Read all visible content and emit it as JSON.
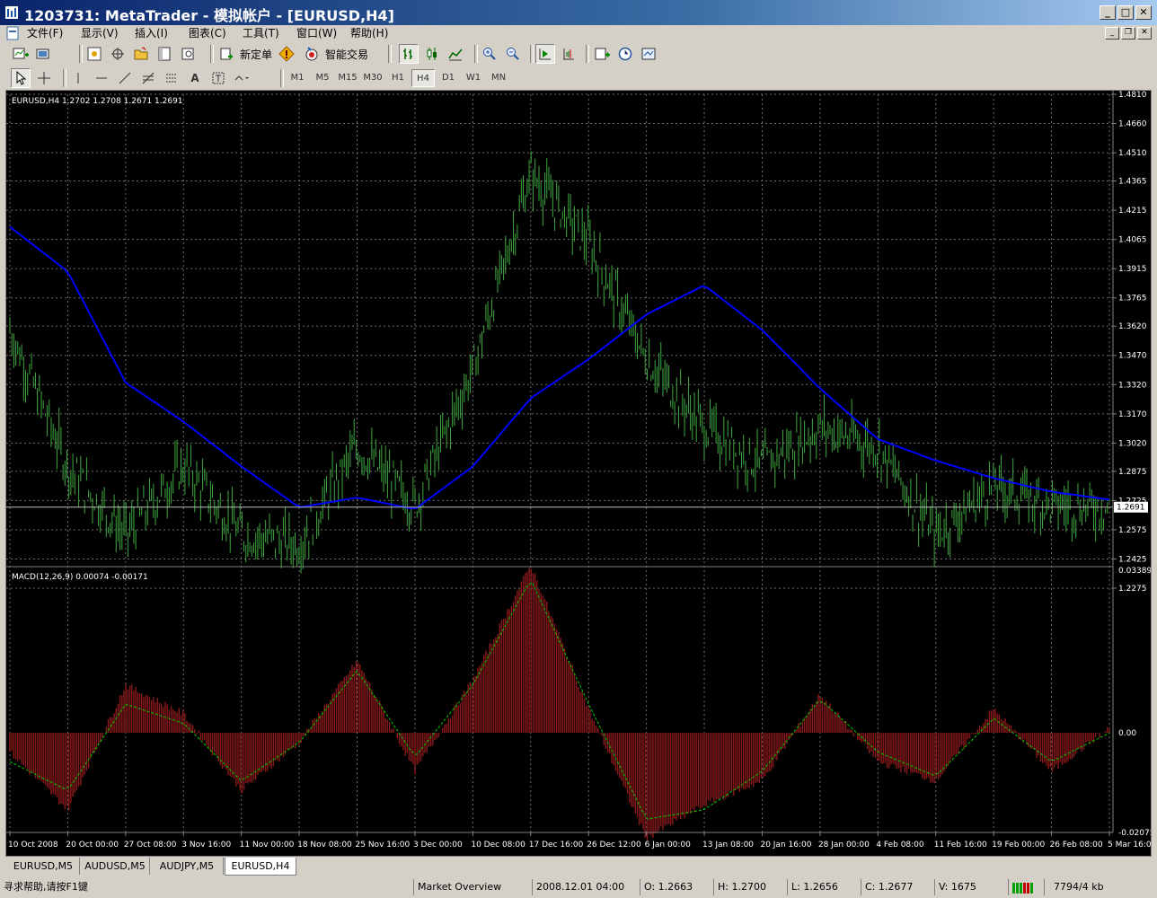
{
  "window": {
    "title": "1203731: MetaTrader - 模拟帐户 - [EURUSD,H4]"
  },
  "menu": [
    "文件(F)",
    "显示(V)",
    "插入(I)",
    "图表(C)",
    "工具(T)",
    "窗口(W)",
    "帮助(H)"
  ],
  "toolbar": {
    "new_order": "新定单",
    "expert_advisors": "智能交易"
  },
  "timeframes": [
    "M1",
    "M5",
    "M15",
    "M30",
    "H1",
    "H4",
    "D1",
    "W1",
    "MN"
  ],
  "active_timeframe": "H4",
  "chart_data": [
    {
      "type": "bar",
      "info_label": "EURUSD,H4  1.2702 1.2708 1.2671 1.2691",
      "y_ticks": [
        "1.4810",
        "1.4660",
        "1.4510",
        "1.4365",
        "1.4215",
        "1.4065",
        "1.3915",
        "1.3765",
        "1.3620",
        "1.3470",
        "1.3320",
        "1.3170",
        "1.3020",
        "1.2875",
        "1.2725",
        "1.2575",
        "1.2425",
        "1.2275"
      ],
      "ylim": [
        1.2275,
        1.481
      ],
      "current_price": "1.2691",
      "series": [
        {
          "name": "",
          "color": "#3fa83f",
          "x": [
            "10 Oct 2008",
            "20 Oct 00:00",
            "27 Oct 08:00",
            "3 Nov 16:00",
            "11 Nov 00:00",
            "18 Nov 08:00",
            "25 Nov 16:00",
            "3 Dec 00:00",
            "10 Dec 08:00",
            "17 Dec 16:00",
            "26 Dec 12:00",
            "6 Jan 00:00",
            "13 Jan 08:00",
            "20 Jan 16:00",
            "28 Jan 00:00",
            "4 Feb 08:00",
            "11 Feb 16:00",
            "19 Feb 00:00",
            "26 Feb 08:00",
            "5 Mar 16:00"
          ],
          "values": [
            1.36,
            1.29,
            1.255,
            1.29,
            1.255,
            1.25,
            1.3,
            1.27,
            1.34,
            1.44,
            1.405,
            1.345,
            1.31,
            1.29,
            1.31,
            1.3,
            1.255,
            1.28,
            1.27,
            1.269
          ]
        },
        {
          "name": "",
          "color": "#0000ff",
          "x": [
            "10 Oct 2008",
            "20 Oct 00:00",
            "27 Oct 08:00",
            "3 Nov 16:00",
            "11 Nov 00:00",
            "18 Nov 08:00",
            "25 Nov 16:00",
            "3 Dec 00:00",
            "10 Dec 08:00",
            "17 Dec 16:00",
            "26 Dec 12:00",
            "6 Jan 00:00",
            "13 Jan 08:00",
            "20 Jan 16:00",
            "28 Jan 00:00",
            "4 Feb 08:00",
            "11 Feb 16:00",
            "19 Feb 00:00",
            "26 Feb 08:00",
            "5 Mar 16:00"
          ],
          "values": [
            1.413,
            1.39,
            1.333,
            1.313,
            1.29,
            1.269,
            1.274,
            1.268,
            1.29,
            1.325,
            1.345,
            1.368,
            1.383,
            1.36,
            1.33,
            1.304,
            1.293,
            1.284,
            1.277,
            1.273
          ]
        }
      ]
    },
    {
      "type": "bar",
      "info_label": "MACD(12,26,9) 0.00074 -0.00171",
      "y_ticks": [
        "0.03389",
        "0.00",
        "-0.02075"
      ],
      "ylim": [
        -0.02075,
        0.03389
      ],
      "series": [
        {
          "name": "",
          "color": "#8b1a1a",
          "x": [
            "10 Oct 2008",
            "20 Oct 00:00",
            "27 Oct 08:00",
            "3 Nov 16:00",
            "11 Nov 00:00",
            "18 Nov 08:00",
            "25 Nov 16:00",
            "3 Dec 00:00",
            "10 Dec 08:00",
            "17 Dec 16:00",
            "26 Dec 12:00",
            "6 Jan 00:00",
            "13 Jan 08:00",
            "20 Jan 16:00",
            "28 Jan 00:00",
            "4 Feb 08:00",
            "11 Feb 16:00",
            "19 Feb 00:00",
            "26 Feb 08:00",
            "5 Mar 16:00"
          ],
          "values": [
            -0.004,
            -0.016,
            0.01,
            0.004,
            -0.012,
            -0.002,
            0.015,
            -0.008,
            0.011,
            0.035,
            0.005,
            -0.022,
            -0.015,
            -0.01,
            0.008,
            -0.006,
            -0.01,
            0.005,
            -0.008,
            0.001
          ]
        },
        {
          "name": "",
          "color": "#00cc00",
          "x": [
            "10 Oct 2008",
            "20 Oct 00:00",
            "27 Oct 08:00",
            "3 Nov 16:00",
            "11 Nov 00:00",
            "18 Nov 08:00",
            "25 Nov 16:00",
            "3 Dec 00:00",
            "10 Dec 08:00",
            "17 Dec 16:00",
            "26 Dec 12:00",
            "6 Jan 00:00",
            "13 Jan 08:00",
            "20 Jan 16:00",
            "28 Jan 00:00",
            "4 Feb 08:00",
            "11 Feb 16:00",
            "19 Feb 00:00",
            "26 Feb 08:00",
            "5 Mar 16:00"
          ],
          "values": [
            -0.006,
            -0.012,
            0.006,
            0.002,
            -0.01,
            -0.002,
            0.013,
            -0.005,
            0.01,
            0.032,
            0.006,
            -0.018,
            -0.016,
            -0.008,
            0.007,
            -0.004,
            -0.009,
            0.003,
            -0.006,
            0.0
          ]
        }
      ]
    }
  ],
  "x_tick_labels": [
    "10 Oct 2008",
    "20 Oct 00:00",
    "27 Oct 08:00",
    "3 Nov 16:00",
    "11 Nov 00:00",
    "18 Nov 08:00",
    "25 Nov 16:00",
    "3 Dec 00:00",
    "10 Dec 08:00",
    "17 Dec 16:00",
    "26 Dec 12:00",
    "6 Jan 00:00",
    "13 Jan 08:00",
    "20 Jan 16:00",
    "28 Jan 00:00",
    "4 Feb 08:00",
    "11 Feb 16:00",
    "19 Feb 00:00",
    "26 Feb 08:00",
    "5 Mar 16:00"
  ],
  "tabs": [
    "EURUSD,M5",
    "AUDUSD,M5",
    "AUDJPY,M5",
    "EURUSD,H4"
  ],
  "active_tab": "EURUSD,H4",
  "status": {
    "help": "寻求帮助,请按F1键",
    "profile": "Market Overview",
    "datetime": "2008.12.01 04:00",
    "open": "O: 1.2663",
    "high": "H: 1.2700",
    "low": "L: 1.2656",
    "close": "C: 1.2677",
    "volume": "V: 1675",
    "traffic": "7794/4 kb"
  },
  "colors": {
    "background": "#000000",
    "grid": "#6e6e6e",
    "price_bars": "#3fa83f",
    "ma_line": "#0000ff",
    "histogram": "#8b1a1a",
    "signal": "#00cc00",
    "titlebar": "#0a246a"
  }
}
